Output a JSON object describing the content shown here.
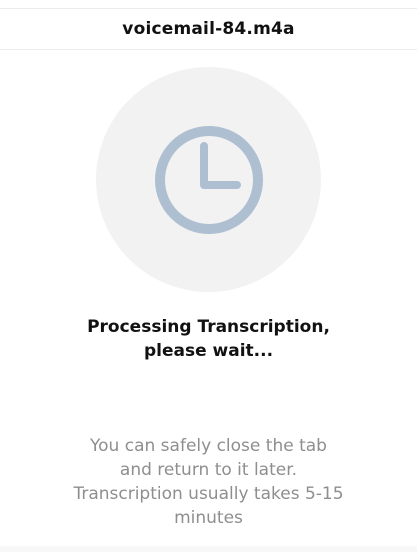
{
  "header": {
    "file_name": "voicemail-84.m4a"
  },
  "status": {
    "icon": "clock-icon",
    "title_line_1": "Processing Transcription,",
    "title_line_2": "please wait...",
    "info_line_1": "You can safely close the tab",
    "info_line_2": "and return to it later.",
    "info_line_3": "Transcription usually takes 5-15",
    "info_line_4": "minutes"
  },
  "colors": {
    "background": "#ffffff",
    "circle_background": "#f2f2f2",
    "clock_icon": "#adbfd1",
    "title_text": "#111111",
    "info_text": "#8e8e8e",
    "divider": "#ededed"
  }
}
